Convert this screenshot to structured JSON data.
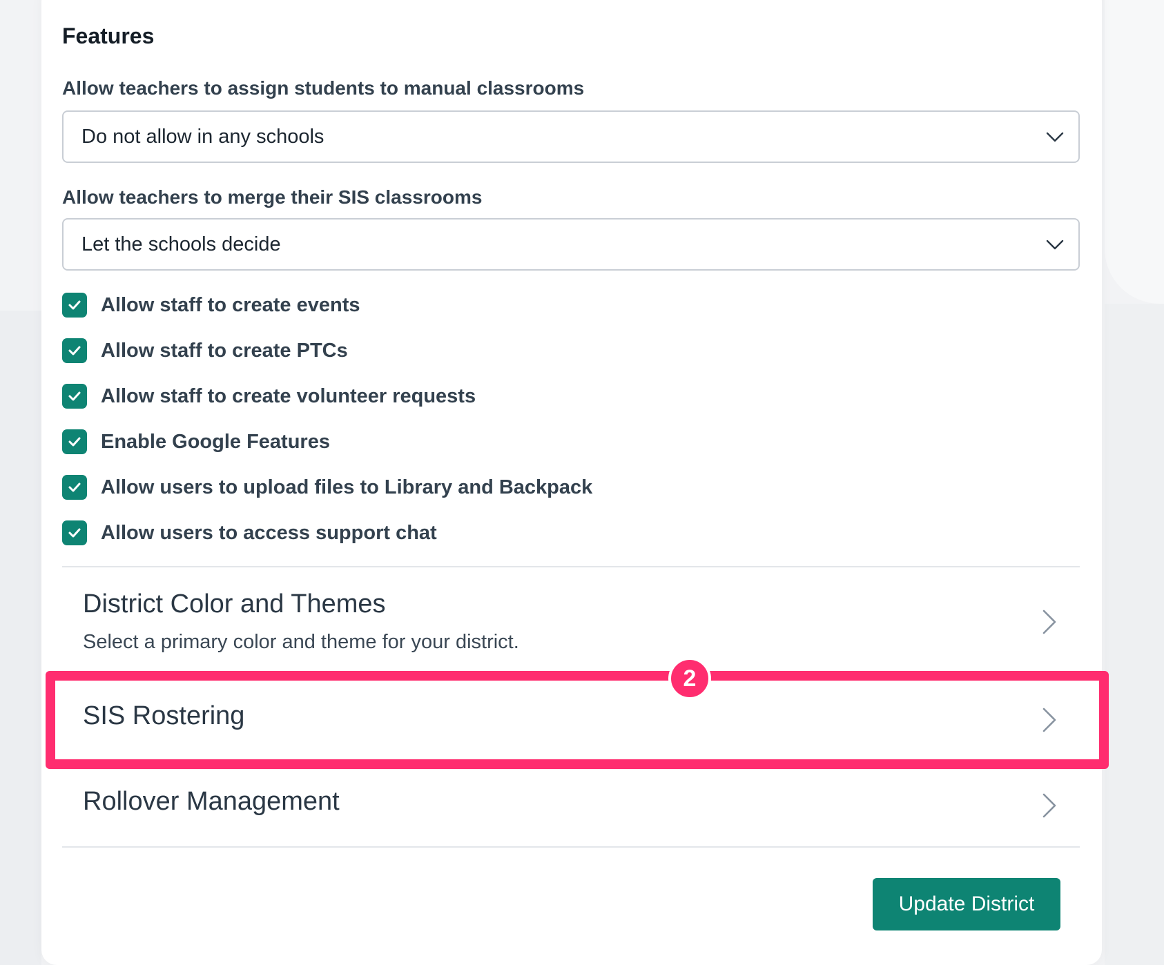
{
  "features": {
    "title": "Features",
    "manual_classrooms": {
      "label": "Allow teachers to assign students to manual classrooms",
      "selected": "Do not allow in any schools"
    },
    "merge_sis": {
      "label": "Allow teachers to merge their SIS classrooms",
      "selected": "Let the schools decide"
    },
    "checkboxes": [
      {
        "label": "Allow staff to create events",
        "checked": true
      },
      {
        "label": "Allow staff to create PTCs",
        "checked": true
      },
      {
        "label": "Allow staff to create volunteer requests",
        "checked": true
      },
      {
        "label": "Enable Google Features",
        "checked": true
      },
      {
        "label": "Allow users to upload files to Library and Backpack",
        "checked": true
      },
      {
        "label": "Allow users to access support chat",
        "checked": true
      }
    ]
  },
  "nav_items": [
    {
      "title": "District Color and Themes",
      "subtitle": "Select a primary color and theme for your district."
    },
    {
      "title": "SIS Rostering"
    },
    {
      "title": "Rollover Management"
    }
  ],
  "annotation": {
    "step": "2",
    "color": "#ff2d6f"
  },
  "actions": {
    "update_label": "Update District"
  },
  "colors": {
    "accent": "#0e8473",
    "highlight": "#ff2d6f"
  },
  "icons": {
    "select_chevron": "chevron-down-icon",
    "nav_chevron": "chevron-right-icon",
    "checkmark": "check-icon"
  }
}
